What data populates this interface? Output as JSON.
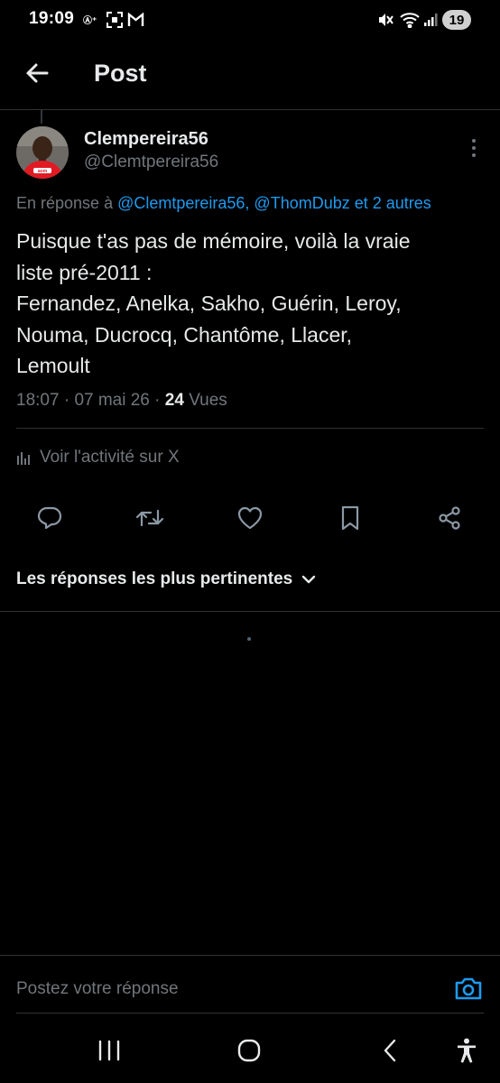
{
  "status_bar": {
    "time": "19:09",
    "battery": "19",
    "icons": [
      "signal-icon",
      "screenshot-icon",
      "gmail-icon",
      "mute-icon",
      "wifi-icon",
      "cell-signal-icon"
    ]
  },
  "header": {
    "title": "Post"
  },
  "post": {
    "author": {
      "display_name": "Clempereira56",
      "handle": "@Clemtpereira56"
    },
    "reply_to": {
      "prefix": "En réponse à",
      "mentions": "@Clemtpereira56, @ThomDubz et 2 autres"
    },
    "text_lines": [
      "Puisque t'as pas de mémoire, voilà la vraie",
      "liste pré-2011 :",
      "Fernandez, Anelka, Sakho, Guérin, Leroy,",
      "Nouma, Ducrocq, Chantôme, Llacer,",
      "Lemoult"
    ],
    "meta": {
      "time": "18:07",
      "date": "07 mai 26",
      "separator": " · ",
      "views_count": "24",
      "views_label": "Vues"
    },
    "activity_label": "Voir l'activité sur X"
  },
  "actions": [
    "reply-icon",
    "repost-icon",
    "like-icon",
    "bookmark-icon",
    "share-icon"
  ],
  "replies": {
    "sort_label": "Les réponses les plus pertinentes"
  },
  "composer": {
    "placeholder": "Postez votre réponse"
  },
  "colors": {
    "background": "#000000",
    "text": "#e7e9ea",
    "secondary": "#71767b",
    "accent": "#1d9bf0",
    "divider": "#2f3336"
  }
}
